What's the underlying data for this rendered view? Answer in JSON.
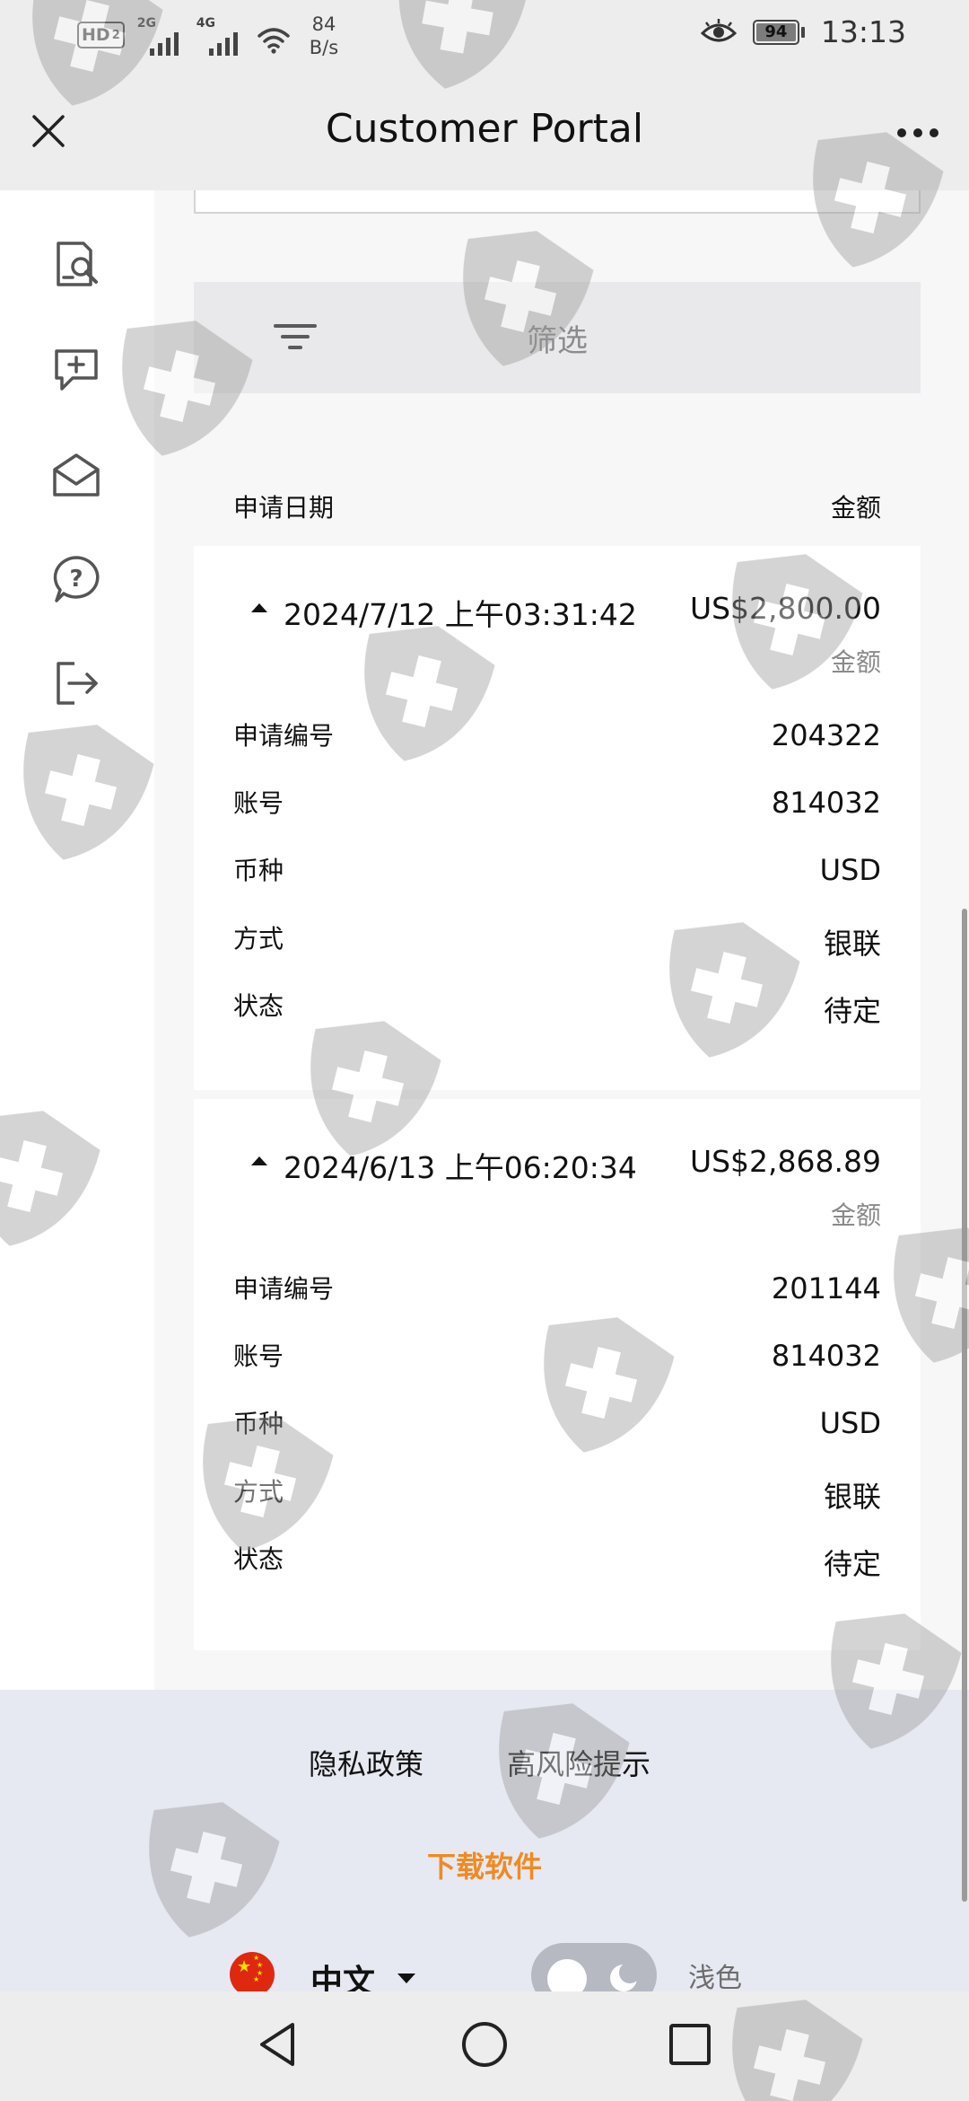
{
  "status_bar": {
    "hd_label": "HD",
    "hd_sub": "2",
    "net1": "2G",
    "net2": "4G",
    "speed_value": "84",
    "speed_unit": "B/s",
    "battery": "94",
    "time": "13:13"
  },
  "header": {
    "title": "Customer Portal"
  },
  "sidebar": {
    "items": [
      {
        "icon": "document-search-icon"
      },
      {
        "icon": "add-chat-icon"
      },
      {
        "icon": "mail-open-icon"
      },
      {
        "icon": "help-icon"
      },
      {
        "icon": "logout-icon"
      }
    ]
  },
  "filter": {
    "label": "筛选"
  },
  "list_header": {
    "date": "申请日期",
    "amount": "金额"
  },
  "records": [
    {
      "date": "2024/7/12 上午03:31:42",
      "amount": "US$2,800.00",
      "amount_label": "金额",
      "fields": [
        {
          "key": "申请编号",
          "value": "204322"
        },
        {
          "key": "账号",
          "value": "814032"
        },
        {
          "key": "币种",
          "value": "USD"
        },
        {
          "key": "方式",
          "value": "银联"
        },
        {
          "key": "状态",
          "value": "待定"
        }
      ]
    },
    {
      "date": "2024/6/13 上午06:20:34",
      "amount": "US$2,868.89",
      "amount_label": "金额",
      "fields": [
        {
          "key": "申请编号",
          "value": "201144"
        },
        {
          "key": "账号",
          "value": "814032"
        },
        {
          "key": "币种",
          "value": "USD"
        },
        {
          "key": "方式",
          "value": "银联"
        },
        {
          "key": "状态",
          "value": "待定"
        }
      ]
    }
  ],
  "footer": {
    "privacy": "隐私政策",
    "risk": "高风险提示",
    "download": "下载软件",
    "language": "中文",
    "theme": "浅色"
  },
  "colors": {
    "accent_orange": "#f08a24",
    "chrome_gray": "#ededed",
    "footer_bg": "#e6e9f1"
  }
}
